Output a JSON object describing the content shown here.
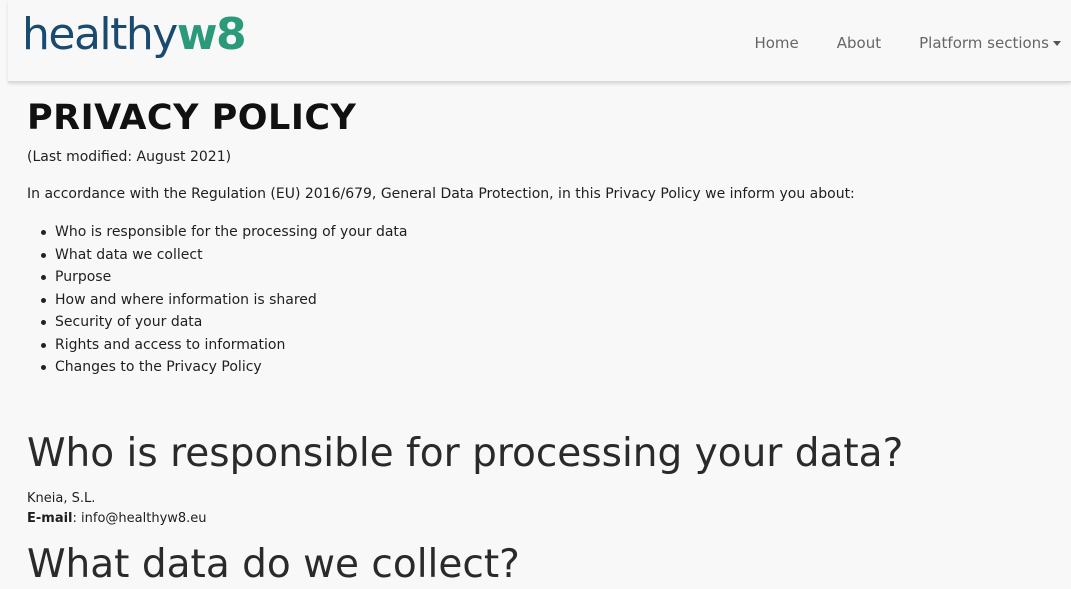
{
  "header": {
    "logo_main": "healthy",
    "logo_accent": "w8",
    "nav": [
      {
        "label": "Home"
      },
      {
        "label": "About"
      },
      {
        "label": "Platform sections"
      }
    ]
  },
  "page": {
    "title": "PRIVACY POLICY",
    "last_modified": "(Last modified: August 2021)",
    "intro": "In accordance with the Regulation (EU) 2016/679, General Data Protection, in this Privacy Policy we inform you about:",
    "toc": [
      "Who is responsible for the processing of your data",
      "What data we collect",
      "Purpose",
      "How and where information is shared",
      "Security of your data",
      "Rights and access to information",
      "Changes to the Privacy Policy"
    ],
    "sections": [
      {
        "heading": "Who is responsible for processing your data?",
        "org": "Kneia, S.L.",
        "email_label": "E-mail",
        "email_sep": ": ",
        "email_value": "info@healthyw8.eu"
      },
      {
        "heading": "What data do we collect?"
      }
    ]
  }
}
